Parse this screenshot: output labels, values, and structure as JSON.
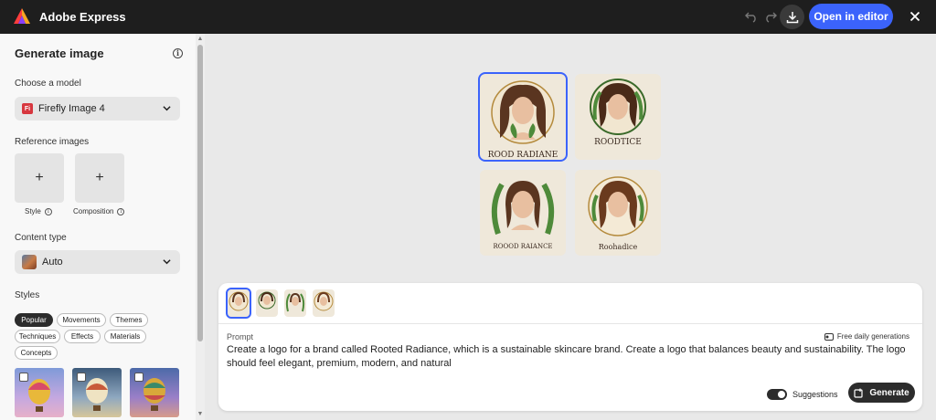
{
  "app": {
    "title": "Adobe Express"
  },
  "topbar": {
    "open_editor_label": "Open in editor"
  },
  "sidebar": {
    "title": "Generate image",
    "model_label": "Choose a model",
    "model_value": "Firefly Image 4",
    "model_badge": "Fi",
    "reference_label": "Reference images",
    "reference_items": [
      {
        "label": "Style",
        "plus": "+"
      },
      {
        "label": "Composition",
        "plus": "+"
      }
    ],
    "content_type_label": "Content type",
    "content_type_value": "Auto",
    "styles_label": "Styles",
    "style_chips": [
      "Popular",
      "Movements",
      "Themes",
      "Techniques",
      "Effects",
      "Materials",
      "Concepts"
    ]
  },
  "results": {
    "captions": [
      "ROOD RADIANE",
      "ROODTICE",
      "ROOOD RAIANCE",
      "Roohadice"
    ]
  },
  "prompt_panel": {
    "prompt_label": "Prompt",
    "free_label": "Free daily generations",
    "prompt_text": "Create a logo for a brand called Rooted Radiance, which is a sustainable skincare brand. Create a logo that balances beauty and sustainability. The logo should feel elegant, premium, modern, and natural",
    "suggestions_label": "Suggestions",
    "generate_label": "Generate"
  },
  "colors": {
    "accent": "#3b63fb",
    "topbar": "#1e1e1e"
  }
}
